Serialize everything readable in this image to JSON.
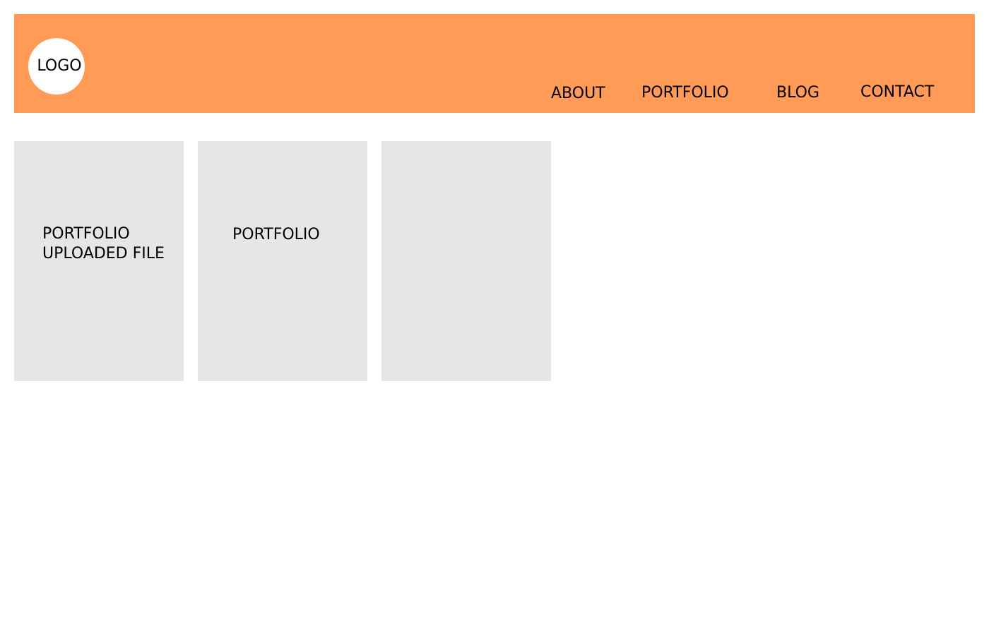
{
  "header": {
    "logo_label": "LOGO",
    "background_color": "#ff9b57",
    "nav": {
      "about": "ABOUT",
      "portfolio": "PORTFOLIO",
      "blog": "BLOG",
      "contact": "CONTACT"
    }
  },
  "portfolio": {
    "tile_color": "#e6e6e6",
    "cards": [
      {
        "title": "PORTFOLIO",
        "subtitle": "UPLOADED FILE"
      },
      {
        "title": "PORTFOLIO"
      },
      {
        "title": ""
      }
    ]
  }
}
